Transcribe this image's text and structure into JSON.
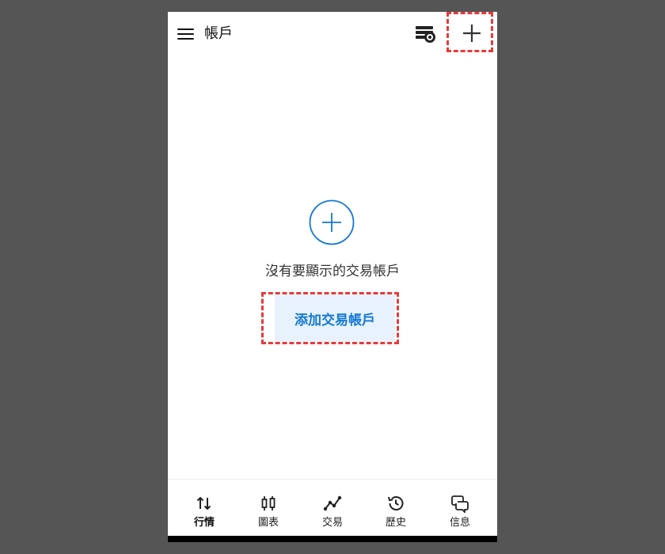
{
  "header": {
    "title": "帳戶"
  },
  "empty_state": {
    "message": "沒有要顯示的交易帳戶",
    "add_button_label": "添加交易帳戶"
  },
  "bottom_nav": {
    "items": [
      {
        "label": "行情",
        "icon": "up-down-arrows-icon",
        "active": true
      },
      {
        "label": "圖表",
        "icon": "candlestick-icon",
        "active": false
      },
      {
        "label": "交易",
        "icon": "trend-line-icon",
        "active": false
      },
      {
        "label": "歷史",
        "icon": "history-clock-icon",
        "active": false
      },
      {
        "label": "信息",
        "icon": "chat-bubbles-icon",
        "active": false
      }
    ]
  },
  "colors": {
    "accent": "#1478d2",
    "highlight": "#e83a3a",
    "button_bg": "#e8f2fc",
    "backdrop": "#555555"
  }
}
